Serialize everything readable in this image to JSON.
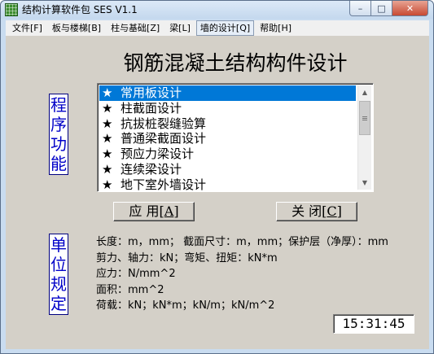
{
  "window": {
    "title": "结构计算软件包 SES V1.1",
    "buttons": {
      "minimize": "–",
      "maximize": "□",
      "close": "✕"
    }
  },
  "menu": [
    {
      "label": "文件[F]",
      "active": false
    },
    {
      "label": "板与楼梯[B]",
      "active": false
    },
    {
      "label": "柱与基础[Z]",
      "active": false
    },
    {
      "label": "梁[L]",
      "active": false
    },
    {
      "label": "墙的设计[Q]",
      "active": true
    },
    {
      "label": "帮助[H]",
      "active": false
    }
  ],
  "heading": "钢筋混凝土结构构件设计",
  "function_label": [
    "程",
    "序",
    "功",
    "能"
  ],
  "unit_label": [
    "单",
    "位",
    "规",
    "定"
  ],
  "list": {
    "bullet": "★",
    "items": [
      {
        "label": "常用板设计",
        "selected": true
      },
      {
        "label": "柱截面设计",
        "selected": false
      },
      {
        "label": "抗拔桩裂缝验算",
        "selected": false
      },
      {
        "label": "普通梁截面设计",
        "selected": false
      },
      {
        "label": "预应力梁设计",
        "selected": false
      },
      {
        "label": "连续梁设计",
        "selected": false
      },
      {
        "label": "地下室外墙设计",
        "selected": false
      }
    ]
  },
  "buttons": {
    "apply_text": "应 用[",
    "apply_key": "A",
    "apply_end": "]",
    "close_text": "关 闭[",
    "close_key": "C",
    "close_end": "]"
  },
  "units": [
    "长度：m，mm；  截面尺寸：m，mm；保护层（净厚）：mm",
    "剪力、轴力：kN；弯矩、扭矩：kN*m",
    "应力：N/mm^2",
    "面积：mm^2",
    "荷载：kN；kN*m；kN/m；kN/m^2"
  ],
  "clock": "15:31:45",
  "colors": {
    "selection": "#0078d7",
    "label_text": "#0000c8",
    "dialog_bg": "#d4d0c8"
  }
}
